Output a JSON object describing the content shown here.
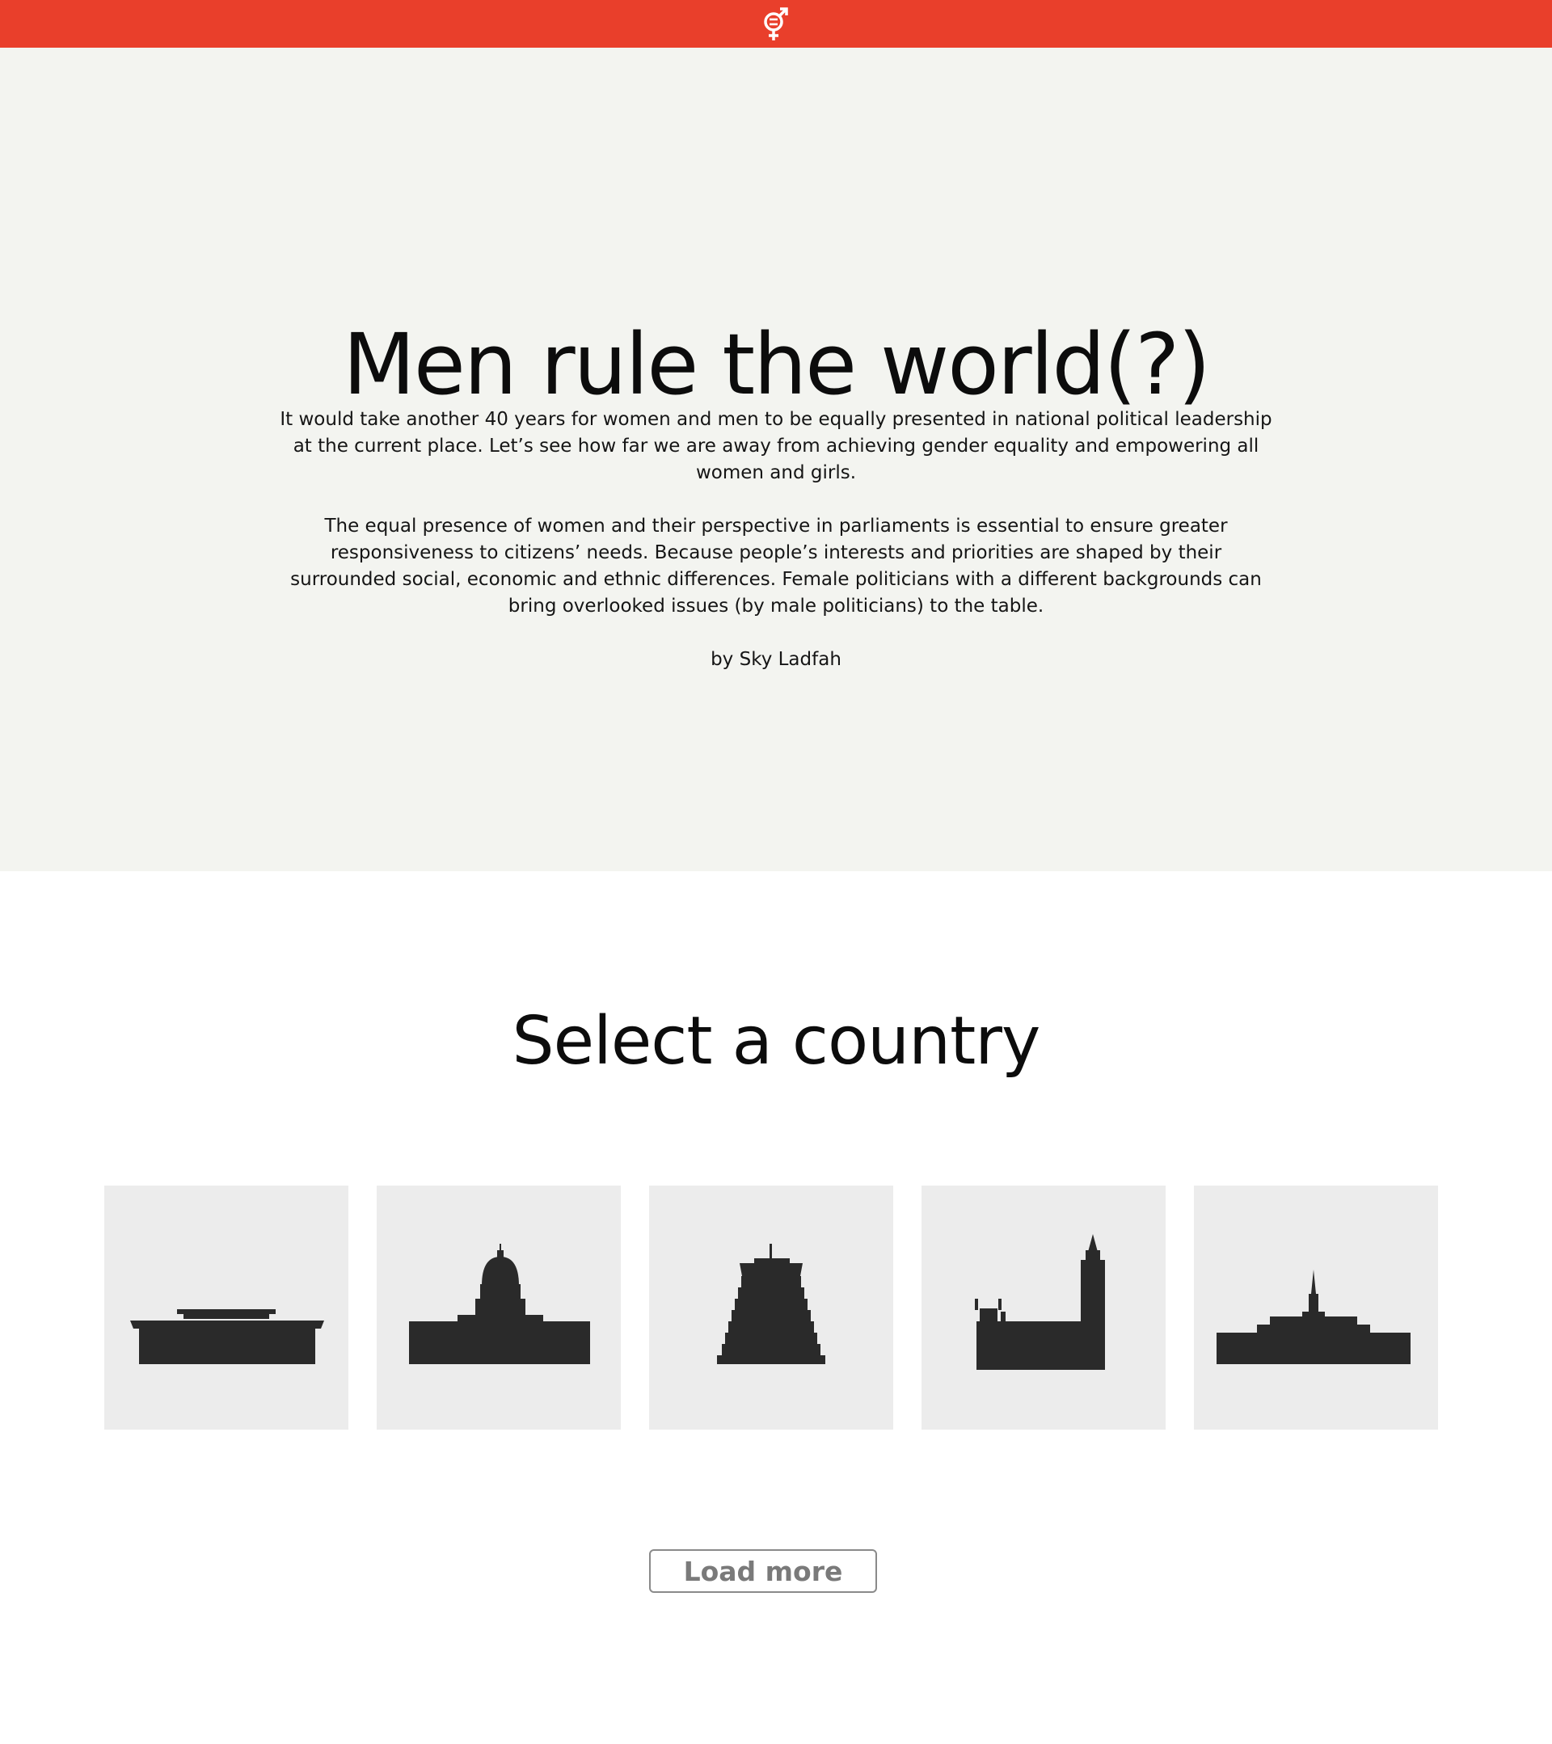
{
  "header": {
    "logo_icon": "gender-equality-icon",
    "bar_color": "#e93f2b"
  },
  "hero": {
    "title": "Men rule the world(?)",
    "paragraph_1": "It would take another 40 years for women and men to be equally presented in national political leadership at the current place. Let’s see how far we are away from achieving gender equality and empowering all women and girls.",
    "paragraph_2": "The equal presence of women and their perspective in parliaments is essential to ensure greater responsiveness to citizens’ needs. Because people’s interests and priorities are shaped by their surrounded social, economic and ethnic differences. Female politicians with a different backgrounds can bring overlooked issues (by male politicians) to the table.",
    "byline": "by Sky Ladfah",
    "background": "#f3f4f0"
  },
  "countries": {
    "title": "Select a country",
    "cards": [
      {
        "icon": "flat-parliament-building-icon"
      },
      {
        "icon": "capitol-dome-building-icon"
      },
      {
        "icon": "beehive-building-icon"
      },
      {
        "icon": "big-ben-parliament-icon"
      },
      {
        "icon": "spire-parliament-building-icon"
      }
    ],
    "card_color": "#ececec",
    "silhouette_color": "#2a2a2a"
  },
  "load_more": {
    "label": "Load more"
  }
}
